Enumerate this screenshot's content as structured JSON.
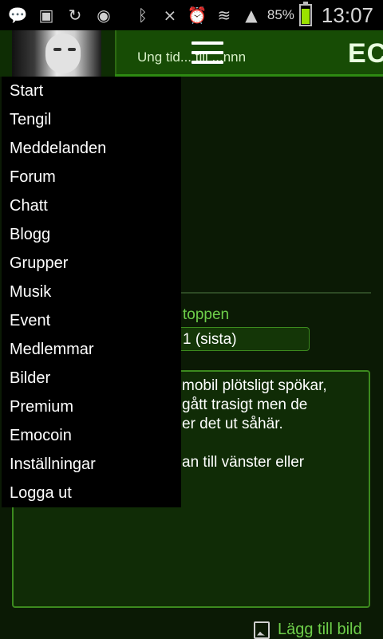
{
  "status_bar": {
    "icons": [
      "messenger-icon",
      "image-icon",
      "sync-icon",
      "media-icon",
      "bluetooth-icon",
      "mute-icon",
      "alarm-icon",
      "wifi-icon",
      "signal-icon"
    ],
    "battery_percent": "85%",
    "time": "13:07"
  },
  "header": {
    "partial_text": "Ung tid... till ...nnn",
    "logo_partial": "EC"
  },
  "drawer": {
    "items": [
      "Start",
      "Tengil",
      "Meddelanden",
      "Forum",
      "Chatt",
      "Blogg",
      "Grupper",
      "Musik",
      "Event",
      "Medlemmar",
      "Bilder",
      "Premium",
      "Emocoin",
      "Inställningar",
      "Logga ut"
    ]
  },
  "content": {
    "top_link": "toppen",
    "page_select_value": "1 (sista)",
    "message_lines": [
      "mobil plötsligt spökar,",
      "gått trasigt men de",
      "er det ut såhär.",
      "",
      "an till vänster eller"
    ],
    "add_image_label": "Lägg till bild"
  },
  "colors": {
    "accent_green": "#6ecf4a",
    "header_green": "#174c05",
    "background": "#0b1a05"
  }
}
